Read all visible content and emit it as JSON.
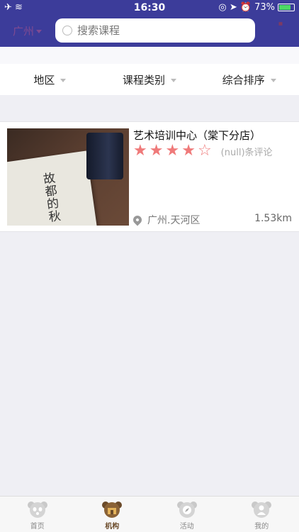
{
  "status": {
    "time": "16:30",
    "battery": "73%",
    "battery_level": 0.73
  },
  "navbar": {
    "city": "广州",
    "search_placeholder": "搜索课程"
  },
  "filters": [
    {
      "label": "地区"
    },
    {
      "label": "课程类别"
    },
    {
      "label": "综合排序"
    }
  ],
  "listing": {
    "name": "艺术培训中心（棠下分店）",
    "rating": 4,
    "rating_max": 5,
    "reviews": "(null)条评论",
    "location": "广州.天河区",
    "distance": "1.53km",
    "book_title": "故都的秋"
  },
  "tabs": [
    {
      "label": "首页",
      "icon": "panda-home-icon"
    },
    {
      "label": "机构",
      "icon": "panda-org-icon"
    },
    {
      "label": "活动",
      "icon": "compass-icon"
    },
    {
      "label": "我的",
      "icon": "profile-icon"
    }
  ],
  "colors": {
    "nav": "#3c3c9a",
    "star": "#ef7a7a",
    "active_tab": "#6b4b2a"
  }
}
